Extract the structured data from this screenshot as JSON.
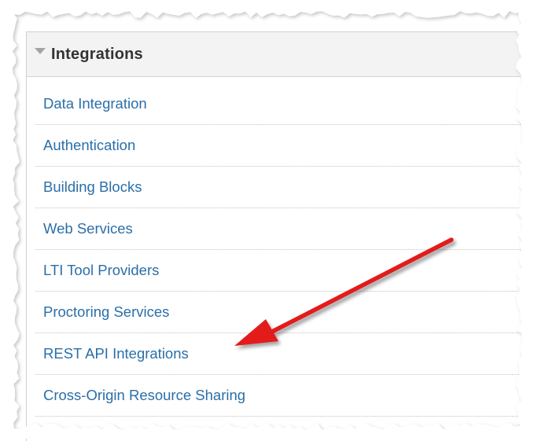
{
  "panel": {
    "title": "Integrations",
    "links": [
      "Data Integration",
      "Authentication",
      "Building Blocks",
      "Web Services",
      "LTI Tool Providers",
      "Proctoring Services",
      "REST API Integrations",
      "Cross-Origin Resource Sharing"
    ]
  },
  "annotation": {
    "arrow_color": "#e31b1b",
    "points_to": "REST API Integrations"
  },
  "colors": {
    "link": "#2a6fa8",
    "header_bg": "#f3f3f3"
  }
}
